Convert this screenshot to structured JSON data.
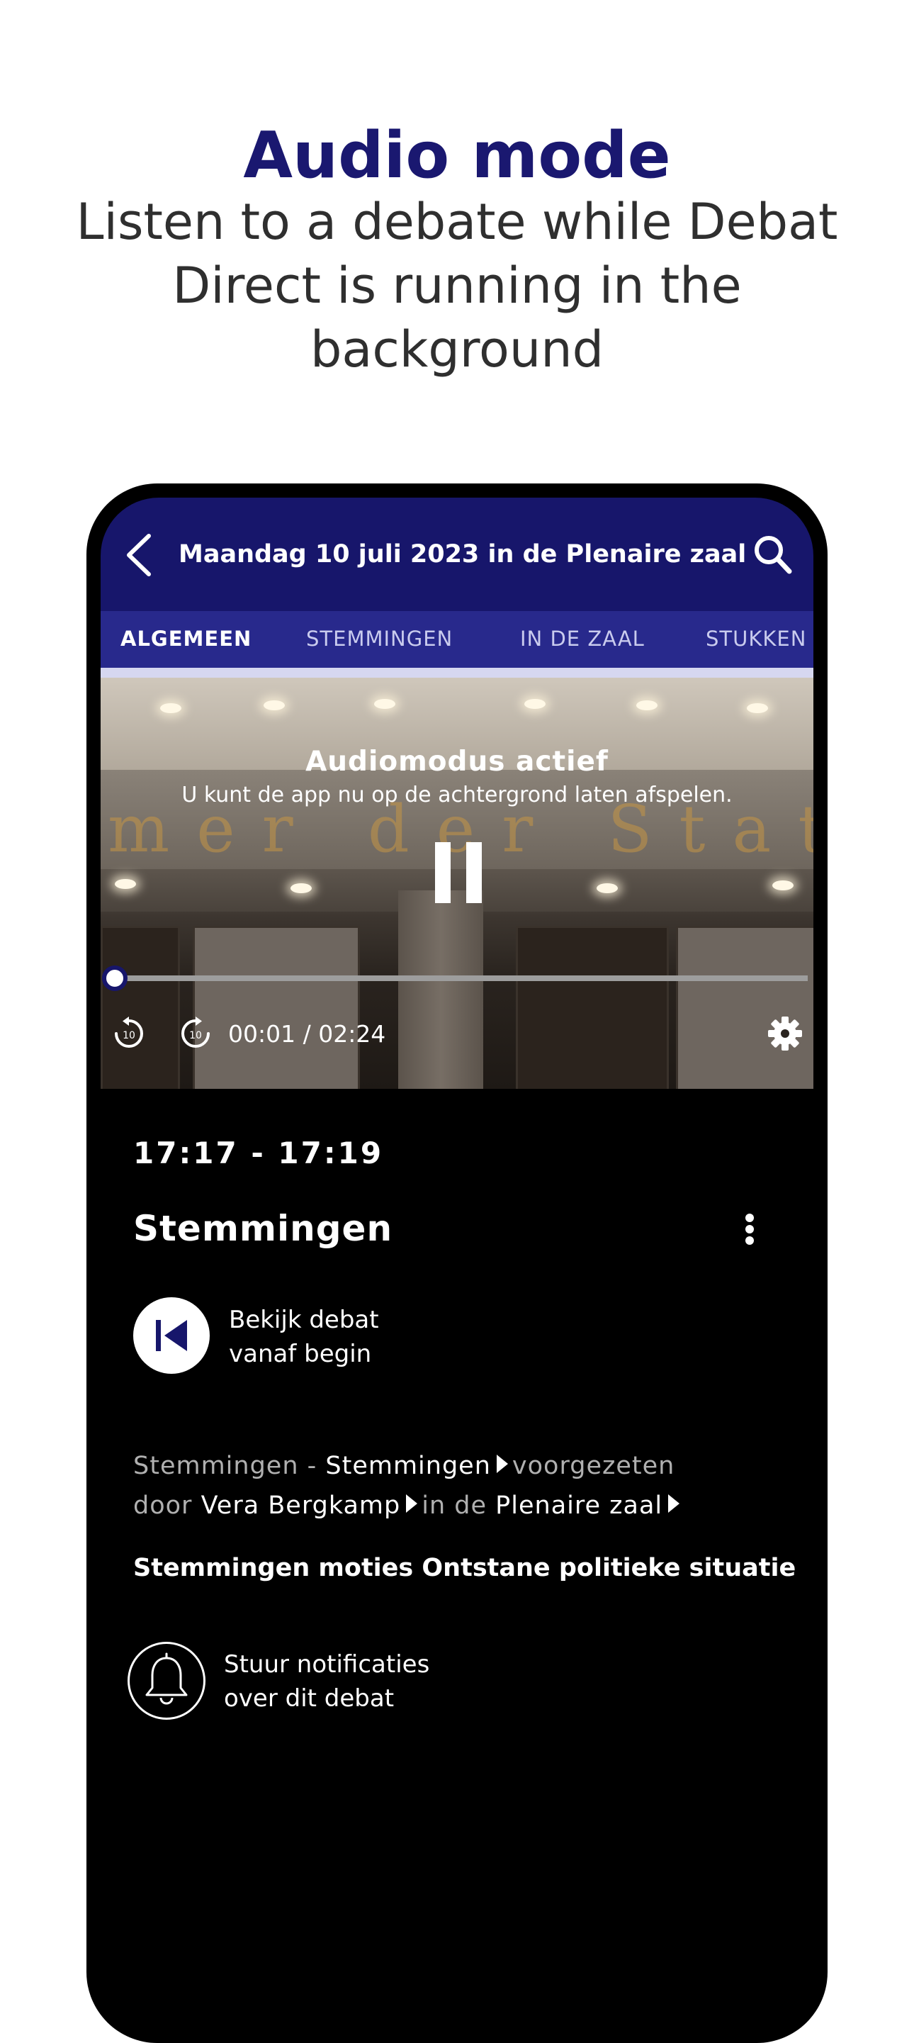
{
  "promo": {
    "title": "Audio mode",
    "subtitle": "Listen to a debate while Debat Direct is running in the background"
  },
  "header": {
    "title": "Maandag 10 juli 2023 in de Plenaire zaal",
    "back_icon": "chevron-left-icon",
    "search_icon": "search-icon"
  },
  "tabs": [
    {
      "label": "ALGEMEEN",
      "active": true
    },
    {
      "label": "STEMMINGEN",
      "active": false
    },
    {
      "label": "IN DE ZAAL",
      "active": false
    },
    {
      "label": "STUKKEN",
      "active": false
    }
  ],
  "player": {
    "overlay_title": "Audiomodus actief",
    "overlay_subtitle": "U kunt de app nu op de achtergrond laten afspelen.",
    "wall_text": "mer der Staten",
    "time_readout": "00:01 / 02:24",
    "progress": 0.007,
    "rewind_label": "10",
    "forward_label": "10"
  },
  "agenda_item": {
    "time_range": "17:17 - 17:19",
    "title": "Stemmingen",
    "start_label_line1": "Bekijk debat",
    "start_label_line2": "vanaf begin",
    "meta": {
      "prefix": "Stemmingen - ",
      "category_link": "Stemmingen",
      "chaired_by_1": "voorgezeten",
      "chaired_by_2": "door ",
      "chair_link": "Vera Bergkamp",
      "location_prefix": "in de ",
      "location_link": "Plenaire zaal"
    },
    "subject": "Stemmingen moties Ontstane politieke situatie",
    "notify_line1": "Stuur notificaties",
    "notify_line2": "over dit debat"
  },
  "colors": {
    "brand_navy": "#17166b",
    "tab_bar": "#28298c",
    "background": "#000000"
  }
}
